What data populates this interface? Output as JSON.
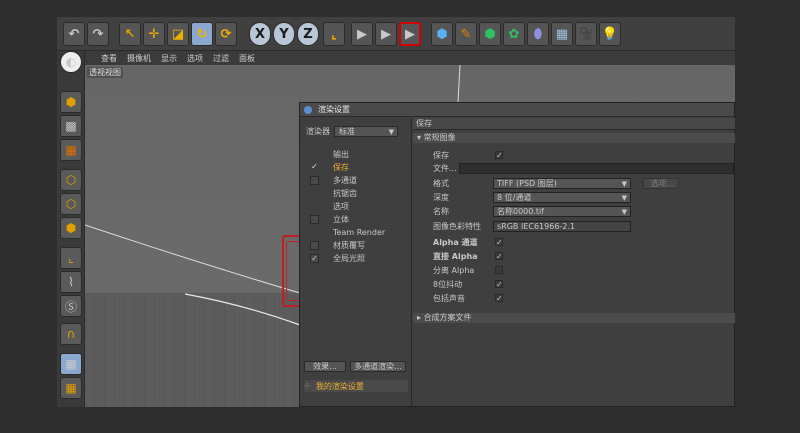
{
  "viewport": {
    "menu": [
      "查看",
      "摄像机",
      "显示",
      "选项",
      "过滤",
      "面板"
    ],
    "label": "透视视图"
  },
  "dialog": {
    "title": "渲染设置",
    "renderer_label": "渲染器",
    "renderer_value": "标准",
    "items": [
      {
        "label": "输出",
        "checked": ""
      },
      {
        "label": "保存",
        "checked": "✓"
      },
      {
        "label": "多通道",
        "checked": "box"
      },
      {
        "label": "抗锯齿",
        "checked": ""
      },
      {
        "label": "选项",
        "checked": ""
      },
      {
        "label": "立体",
        "checked": "box"
      },
      {
        "label": "Team Render",
        "checked": ""
      },
      {
        "label": "材质覆写",
        "checked": "box"
      },
      {
        "label": "全局光照",
        "checked": "✓"
      }
    ],
    "effect_button": "效果...",
    "multipass_button": "多通道渲染...",
    "preset": "我的渲染设置",
    "right_header": "保存",
    "section_general": "常规图像",
    "save_label": "保存",
    "file_label": "文件...",
    "format_label": "格式",
    "format_value": "TIFF (PSD 图层)",
    "options_button": "选项...",
    "depth_label": "深度",
    "depth_value": "8 位/通道",
    "name_label": "名称",
    "name_value": "名称0000.tif",
    "profile_label": "图像色彩特性",
    "profile_value": "sRGB IEC61966-2.1",
    "alpha_label": "Alpha 通道",
    "straight_alpha_label": "直接 Alpha",
    "separate_alpha_label": "分离 Alpha",
    "dither_label": "8位抖动",
    "sound_label": "包括声音",
    "section_compositing": "合成方案文件",
    "check_mark": "✓"
  }
}
